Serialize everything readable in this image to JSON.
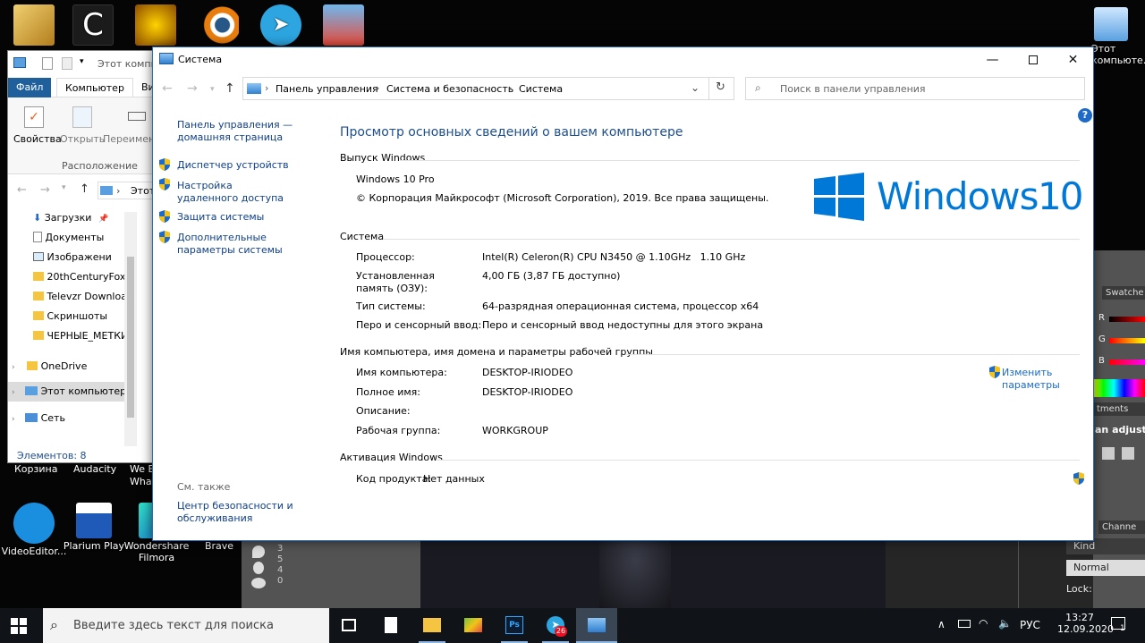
{
  "desktop": {
    "icons_top": [
      {
        "name": "game-figure",
        "color": "#d3a33a"
      },
      {
        "name": "ccleaner",
        "color": "#1b1b1b"
      },
      {
        "name": "fire-app",
        "color": "#d88a00"
      },
      {
        "name": "blender",
        "color": "#e87d0d"
      },
      {
        "name": "telegram",
        "color": "#2ca5e0"
      },
      {
        "name": "avatar-app",
        "color": "#4aa3e0"
      }
    ],
    "right_icon_label": "Этот компьюте...",
    "bottom_labels": [
      "Корзина",
      "Audacity",
      "We B What"
    ],
    "row2_labels": [
      "VideoEditor...",
      "Plarium Play",
      "Wondershare Filmora",
      "Brave"
    ]
  },
  "photoshop": {
    "swatches_tab": "Swatche",
    "rgb": [
      "R",
      "G",
      "B"
    ],
    "adjustments_tab": "tments",
    "adjustments_label": "an adjustr",
    "channels_tab": "Channe",
    "kind": "Kind",
    "blend": "Normal",
    "lock": "Lock:"
  },
  "explorer": {
    "title": "Этот компь",
    "tabs": {
      "file": "Файл",
      "computer": "Компьютер",
      "view": "Ви"
    },
    "ribbon": {
      "properties": "Свойства",
      "open": "Открыть",
      "rename": "Переимен",
      "group": "Расположение"
    },
    "address": "Этот",
    "tree": [
      {
        "label": "Загрузки",
        "icon": "download-icon"
      },
      {
        "label": "Документы",
        "icon": "document-icon"
      },
      {
        "label": "Изображени",
        "icon": "picture-icon"
      },
      {
        "label": "20thCenturyFox",
        "icon": "folder-icon"
      },
      {
        "label": "Televzr Downloa",
        "icon": "folder-icon"
      },
      {
        "label": "Скриншоты",
        "icon": "folder-icon"
      },
      {
        "label": "ЧЕРНЫЕ_МЕТКИ",
        "icon": "folder-icon"
      }
    ],
    "onedrive": "OneDrive",
    "this_pc": "Этот компьютер",
    "network": "Сеть",
    "status": "Элементов: 8"
  },
  "system": {
    "window_title": "Система",
    "breadcrumb": [
      "Панель управления",
      "Система и безопасность",
      "Система"
    ],
    "search_placeholder": "Поиск в панели управления",
    "left_nav": {
      "home": "Панель управления — домашняя страница",
      "links": [
        "Диспетчер устройств",
        "Настройка удаленного доступа",
        "Защита системы",
        "Дополнительные параметры системы"
      ],
      "see_also": "См. также",
      "security_center": "Центр безопасности и обслуживания"
    },
    "heading": "Просмотр основных сведений о вашем компьютере",
    "edition": {
      "section": "Выпуск Windows",
      "name": "Windows 10 Pro",
      "copyright": "© Корпорация Майкрософт (Microsoft Corporation), 2019. Все права защищены.",
      "logo_text": "Windows",
      "logo_version": "10"
    },
    "system_section": {
      "section": "Система",
      "rows": [
        {
          "label": "Процессор:",
          "value": "Intel(R) Celeron(R) CPU N3450 @ 1.10GHz   1.10 GHz"
        },
        {
          "label": "Установленная память (ОЗУ):",
          "value": "4,00 ГБ (3,87 ГБ доступно)"
        },
        {
          "label": "Тип системы:",
          "value": "64-разрядная операционная система, процессор x64"
        },
        {
          "label": "Перо и сенсорный ввод:",
          "value": "Перо и сенсорный ввод недоступны для этого экрана"
        }
      ]
    },
    "computer_section": {
      "section": "Имя компьютера, имя домена и параметры рабочей группы",
      "rows": [
        {
          "label": "Имя компьютера:",
          "value": "DESKTOP-IRIODEO"
        },
        {
          "label": "Полное имя:",
          "value": "DESKTOP-IRIODEO"
        },
        {
          "label": "Описание:",
          "value": ""
        },
        {
          "label": "Рабочая группа:",
          "value": "WORKGROUP"
        }
      ],
      "change_link": "Изменить параметры"
    },
    "activation": {
      "section": "Активация Windows",
      "product_key_label": "Код продукта:",
      "product_key_value": "Нет данных"
    }
  },
  "taskbar": {
    "search_placeholder": "Введите здесь текст для поиска",
    "telegram_badge": "26",
    "lang": "РУС",
    "time": "13:27",
    "date": "12.09.2020",
    "notification_count": "1"
  },
  "colors": {
    "accent": "#0078d7",
    "link": "#0e3f8b",
    "heading": "#1e4e8c",
    "taskbar": "#101418"
  }
}
